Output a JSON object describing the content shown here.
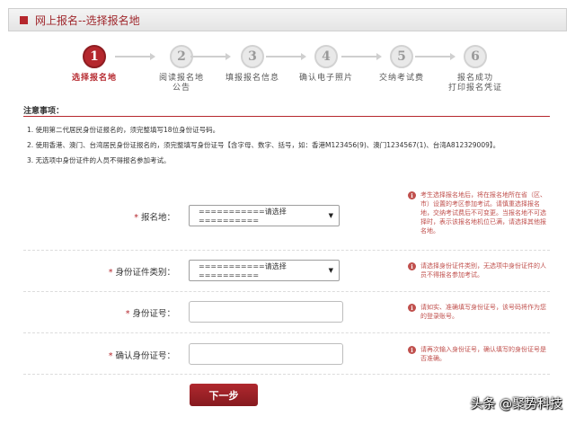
{
  "header": {
    "title": "网上报名--选择报名地"
  },
  "steps": [
    {
      "num": "1",
      "label": "选择报名地",
      "label2": ""
    },
    {
      "num": "2",
      "label": "阅读报名地",
      "label2": "公告"
    },
    {
      "num": "3",
      "label": "填报报名信息",
      "label2": ""
    },
    {
      "num": "4",
      "label": "确认电子照片",
      "label2": ""
    },
    {
      "num": "5",
      "label": "交纳考试费",
      "label2": ""
    },
    {
      "num": "6",
      "label": "报名成功",
      "label2": "打印报名凭证"
    }
  ],
  "notice": {
    "title": "注意事项：",
    "items": [
      "1. 使用第二代居民身份证报名的，须完整填写18位身份证号码。",
      "2. 使用香港、澳门、台湾居民身份证报名的，须完整填写身份证号【含字母、数字、括号，如：香港M123456(9)、澳门1234567(1)、台湾A812329009】。",
      "3. 无选项中身份证件的人员不得报名参加考试。"
    ]
  },
  "form": {
    "required_mark": "*",
    "location": {
      "label": "报名地：",
      "value": "===========请选择==========",
      "tip": "考生选择报名地后，将在报名地所在省（区、市）设置的考区参加考试。请慎重选择报名地，交纳考试费后不可变更。当报名地不可选择时，表示该报名地机位已满，请选择其他报名地。"
    },
    "id_type": {
      "label": "身份证件类别：",
      "value": "===========请选择==========",
      "tip": "请选择身份证件类别，无选项中身份证件的人员不得报名参加考试。"
    },
    "id_number": {
      "label": "身份证号：",
      "tip": "请如实、准确填写身份证号，该号码将作为您的登录账号。"
    },
    "id_confirm": {
      "label": "确认身份证号：",
      "tip": "请再次输入身份证号，确认填写的身份证号是否准确。"
    },
    "caret": "▼",
    "info_glyph": "i"
  },
  "actions": {
    "next_label": "下一步"
  },
  "watermark": "头条 @聚势科技",
  "colors": {
    "accent": "#b5272d",
    "tip": "#c0504d"
  }
}
